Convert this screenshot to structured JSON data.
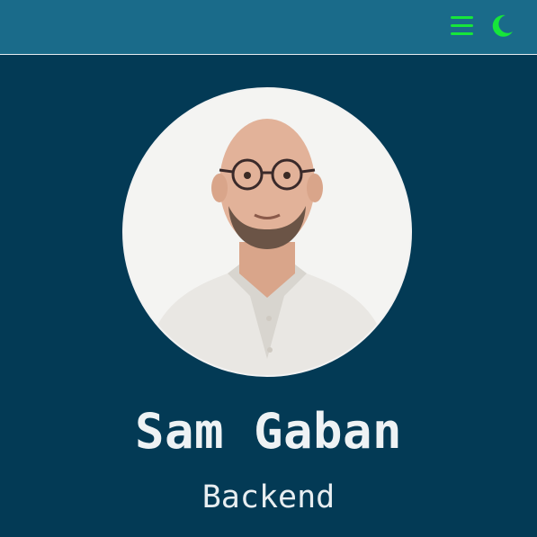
{
  "header": {
    "menu_icon": "hamburger-menu-icon",
    "theme_icon": "crescent-moon-icon",
    "accent_color": "#16e63a",
    "background_color": "#1a6b8a"
  },
  "profile": {
    "name": "Sam Gaban",
    "role": "Backend",
    "photo_alt": "Sam Gaban"
  },
  "colors": {
    "page_background": "#033a55",
    "text": "#eef2f4"
  }
}
